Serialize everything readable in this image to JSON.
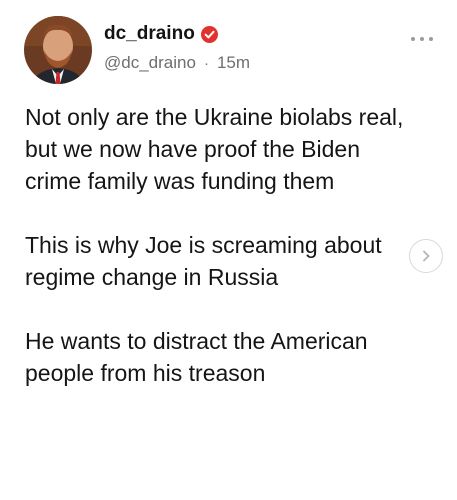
{
  "post": {
    "author": {
      "display_name": "dc_draino",
      "handle": "@dc_draino",
      "verified": true,
      "avatar_icon": "profile-photo"
    },
    "timestamp": "15m",
    "separator": "·",
    "paragraphs": [
      "Not only are the Ukraine biolabs real, but we now have proof the Biden crime family was funding them",
      "This is why Joe is screaming about regime change in Russia",
      "He wants to distract the American people from his treason"
    ]
  },
  "icons": {
    "more": "more-horizontal-icon",
    "next": "chevron-right-icon",
    "verified": "verified-badge-icon"
  },
  "colors": {
    "verified_badge": "#e1322f",
    "secondary_text": "#6e6e73"
  }
}
